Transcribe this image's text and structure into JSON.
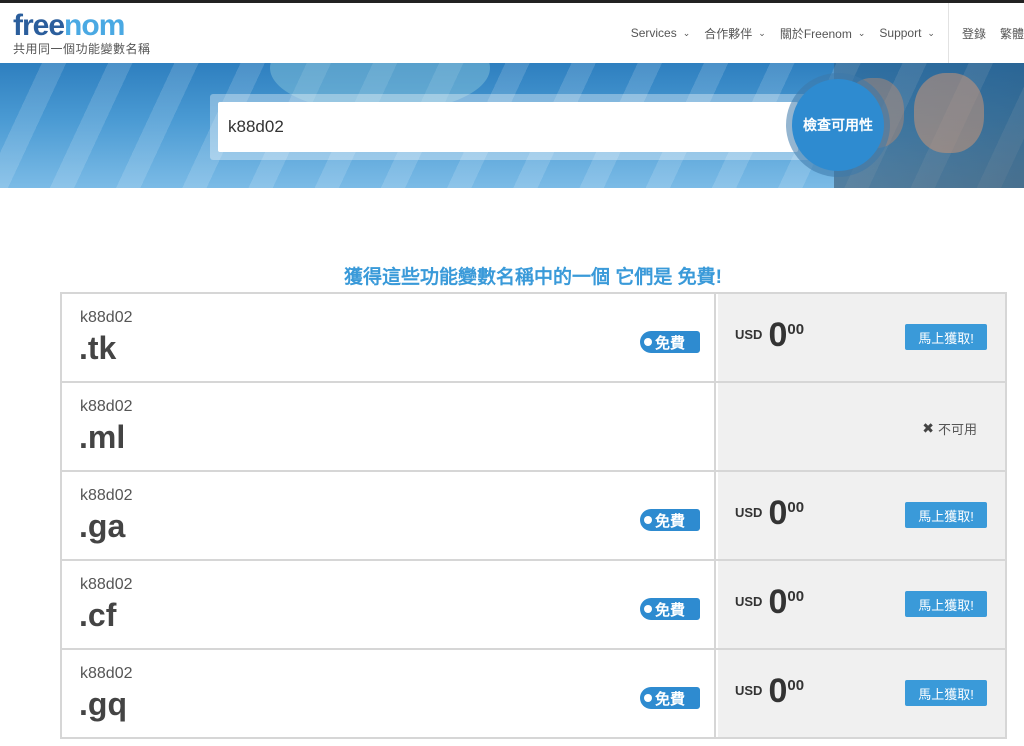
{
  "header": {
    "logo_main": "free",
    "logo_accent": "nom",
    "tagline": "共用同一個功能變數名稱",
    "nav": [
      {
        "label": "Services",
        "has_dropdown": true
      },
      {
        "label": "合作夥伴",
        "has_dropdown": true
      },
      {
        "label": "關於Freenom",
        "has_dropdown": true
      },
      {
        "label": "Support",
        "has_dropdown": true
      }
    ],
    "login": "登錄",
    "language": "繁體"
  },
  "search": {
    "value": "k88d02",
    "button_label": "檢查可用性"
  },
  "headline": "獲得這些功能變數名稱中的一個 它們是 免費!",
  "results": [
    {
      "name": "k88d02",
      "tld": ".tk",
      "free_label": "免費",
      "currency": "USD",
      "price_int": "0",
      "price_dec": "00",
      "buy_label": "馬上獲取!",
      "available": true
    },
    {
      "name": "k88d02",
      "tld": ".ml",
      "unavailable_label": "不可用",
      "available": false
    },
    {
      "name": "k88d02",
      "tld": ".ga",
      "free_label": "免費",
      "currency": "USD",
      "price_int": "0",
      "price_dec": "00",
      "buy_label": "馬上獲取!",
      "available": true
    },
    {
      "name": "k88d02",
      "tld": ".cf",
      "free_label": "免費",
      "currency": "USD",
      "price_int": "0",
      "price_dec": "00",
      "buy_label": "馬上獲取!",
      "available": true
    },
    {
      "name": "k88d02",
      "tld": ".gq",
      "free_label": "免費",
      "currency": "USD",
      "price_int": "0",
      "price_dec": "00",
      "buy_label": "馬上獲取!",
      "available": true
    }
  ],
  "colors": {
    "brand_dark": "#2b5e9c",
    "brand_accent": "#4aa9e3",
    "button_blue": "#3a9ad9",
    "headline_blue": "#3a9ad9"
  }
}
